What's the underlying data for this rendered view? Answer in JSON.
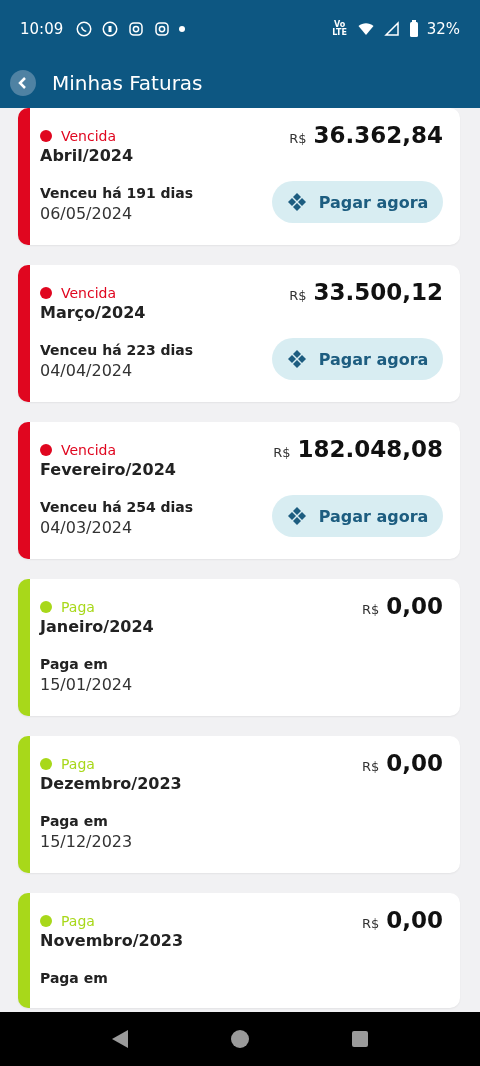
{
  "status_bar": {
    "time": "10:09",
    "network": "Vo LTE",
    "battery": "32%"
  },
  "header": {
    "title": "Minhas Faturas"
  },
  "invoices": [
    {
      "status": "Vencida",
      "color": "#e0061f",
      "month": "Abril/2024",
      "currency": "R$",
      "amount": "36.362,84",
      "due_label": "Venceu há 191 dias",
      "due_date": "06/05/2024",
      "pay_button": "Pagar agora"
    },
    {
      "status": "Vencida",
      "color": "#e0061f",
      "month": "Março/2024",
      "currency": "R$",
      "amount": "33.500,12",
      "due_label": "Venceu há 223 dias",
      "due_date": "04/04/2024",
      "pay_button": "Pagar agora"
    },
    {
      "status": "Vencida",
      "color": "#e0061f",
      "month": "Fevereiro/2024",
      "currency": "R$",
      "amount": "182.048,08",
      "due_label": "Venceu há 254 dias",
      "due_date": "04/03/2024",
      "pay_button": "Pagar agora"
    },
    {
      "status": "Paga",
      "color": "#a8d81a",
      "month": "Janeiro/2024",
      "currency": "R$",
      "amount": "0,00",
      "due_label": "Paga em",
      "due_date": "15/01/2024"
    },
    {
      "status": "Paga",
      "color": "#a8d81a",
      "month": "Dezembro/2023",
      "currency": "R$",
      "amount": "0,00",
      "due_label": "Paga em",
      "due_date": "15/12/2023"
    },
    {
      "status": "Paga",
      "color": "#a8d81a",
      "month": "Novembro/2023",
      "currency": "R$",
      "amount": "0,00",
      "due_label": "Paga em"
    }
  ]
}
